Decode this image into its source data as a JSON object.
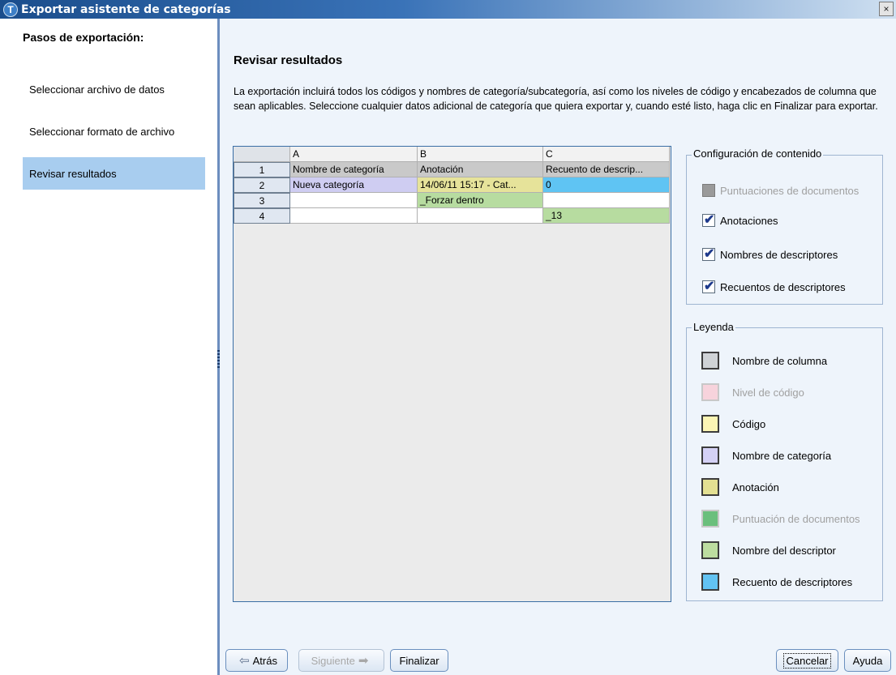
{
  "window": {
    "title": "Exportar asistente de categorías",
    "close_glyph": "×",
    "app_icon_glyph": "T"
  },
  "sidebar": {
    "heading": "Pasos de exportación:",
    "items": [
      {
        "label": "Seleccionar archivo de datos"
      },
      {
        "label": "Seleccionar formato de archivo"
      },
      {
        "label": "Revisar resultados",
        "active": true
      }
    ]
  },
  "main": {
    "title": "Revisar resultados",
    "description": "La exportación incluirá todos los códigos y nombres de categoría/subcategoría, así como los niveles de código y encabezados de columna que sean aplicables. Seleccione cualquier datos adicional de categoría que quiera exportar y, cuando esté listo, haga clic en Finalizar para exportar."
  },
  "grid": {
    "columns": [
      "A",
      "B",
      "C"
    ],
    "rows": [
      {
        "num": "1",
        "cells": [
          "Nombre de categoría",
          "Anotación",
          "Recuento de descrip..."
        ],
        "colors": [
          "#c9c9c9",
          "#c9c9c9",
          "#c9c9c9"
        ]
      },
      {
        "num": "2",
        "cells": [
          "Nueva categoría",
          "14/06/11 15:17 - Cat...",
          "0"
        ],
        "colors": [
          "#cfcdf2",
          "#e6e39a",
          "#5fc4f3"
        ]
      },
      {
        "num": "3",
        "cells": [
          "",
          "_Forzar dentro",
          ""
        ],
        "colors": [
          "#ffffff",
          "#b7dca0",
          "#ffffff"
        ]
      },
      {
        "num": "4",
        "cells": [
          "",
          "",
          "_13"
        ],
        "colors": [
          "#ffffff",
          "#ffffff",
          "#b7dca0"
        ]
      }
    ]
  },
  "config": {
    "title": "Configuración de contenido",
    "options": [
      {
        "label": "Puntuaciones de documentos",
        "checked": false,
        "disabled": true
      },
      {
        "label": "Anotaciones",
        "checked": true,
        "disabled": false
      },
      {
        "label": "Nombres de descriptores",
        "checked": true,
        "disabled": false
      },
      {
        "label": "Recuentos de descriptores",
        "checked": true,
        "disabled": false
      }
    ]
  },
  "legend": {
    "title": "Leyenda",
    "items": [
      {
        "label": "Nombre de columna",
        "color": "#cfd3d6",
        "disabled": false
      },
      {
        "label": "Nivel de código",
        "color": "#f7d3dc",
        "disabled": true
      },
      {
        "label": "Código",
        "color": "#fbf5b4",
        "disabled": false
      },
      {
        "label": "Nombre de categoría",
        "color": "#d4d1f5",
        "disabled": false
      },
      {
        "label": "Anotación",
        "color": "#e3e092",
        "disabled": false
      },
      {
        "label": "Puntuación de documentos",
        "color": "#6abf7c",
        "disabled": true
      },
      {
        "label": "Nombre del descriptor",
        "color": "#bddd9f",
        "disabled": false
      },
      {
        "label": "Recuento de descriptores",
        "color": "#62c3f2",
        "disabled": false
      }
    ]
  },
  "buttons": {
    "back": "Atrás",
    "next": "Siguiente",
    "finish": "Finalizar",
    "cancel": "Cancelar",
    "help": "Ayuda"
  },
  "icons": {
    "back": "arrow-left-icon",
    "next": "arrow-right-icon",
    "check": "checkmark-icon"
  }
}
